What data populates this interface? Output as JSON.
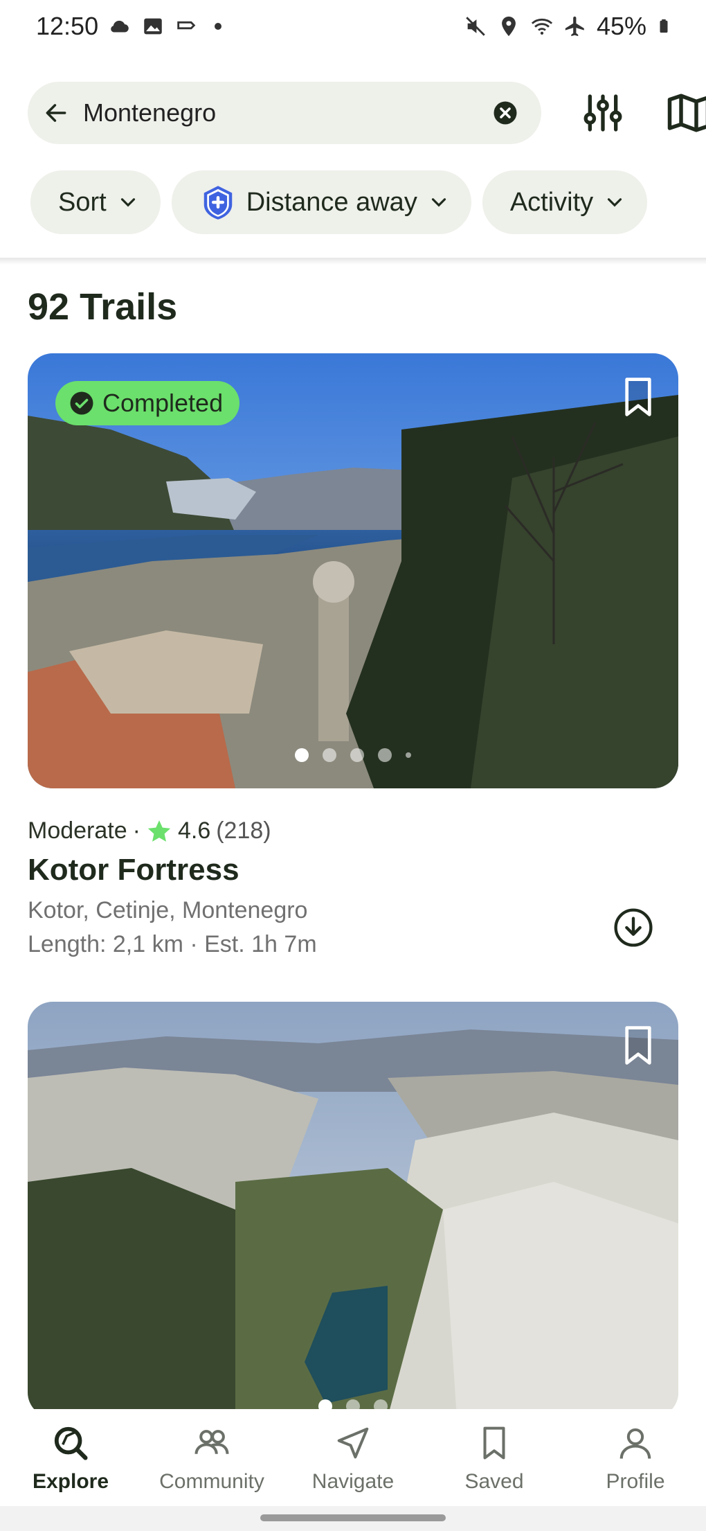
{
  "status_bar": {
    "time": "12:50",
    "battery": "45%"
  },
  "search": {
    "value": "Montenegro"
  },
  "chips": {
    "sort": "Sort",
    "distance": "Distance away",
    "activity": "Activity"
  },
  "results": {
    "count_label": "92 Trails"
  },
  "trails": [
    {
      "badge": "Completed",
      "difficulty": "Moderate",
      "rating": "4.6",
      "reviews": "(218)",
      "name": "Kotor Fortress",
      "location": "Kotor, Cetinje, Montenegro",
      "length": "Length: 2,1 km · Est. 1h 7m"
    }
  ],
  "nav": {
    "explore": "Explore",
    "community": "Community",
    "navigate": "Navigate",
    "saved": "Saved",
    "profile": "Profile"
  },
  "colors": {
    "accent_green": "#6be06c",
    "premium_blue": "#3f63e0",
    "text_dark": "#1f2a1d",
    "chip_bg": "#eef0ea"
  }
}
